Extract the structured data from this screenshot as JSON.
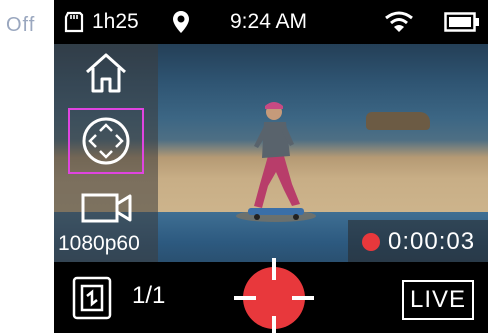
{
  "side_label": "Off",
  "status_bar": {
    "sd_time": "1h25",
    "clock": "9:24 AM",
    "icons": [
      "sd-card-icon",
      "location-pin-icon",
      "wifi-icon",
      "battery-icon"
    ]
  },
  "sidebar": {
    "resolution": "1080p60",
    "icons": [
      "home-icon",
      "joystick-icon",
      "video-camera-icon"
    ],
    "selected_highlight_color": "#e044e0"
  },
  "recording": {
    "elapsed": "0:00:03",
    "dot_color": "#e8383c"
  },
  "bottom_bar": {
    "photo_count": "1/1",
    "live_label": "LIVE",
    "shutter_color": "#e8383c"
  }
}
